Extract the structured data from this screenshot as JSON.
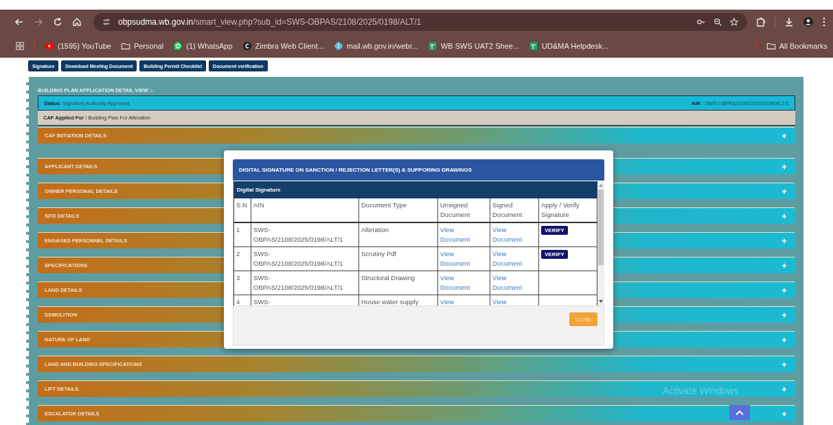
{
  "browser": {
    "url_host": "obpsudma.wb.gov.in",
    "url_path": "/smart_view.php?sub_id=SWS-OBPAS/2108/2025/0198/ALT/1",
    "bookmarks": [
      {
        "kind": "youtube",
        "label": "(1595) YouTube"
      },
      {
        "kind": "folder",
        "label": "Personal"
      },
      {
        "kind": "whatsapp",
        "label": "(1) WhatsApp"
      },
      {
        "kind": "zimbra",
        "label": "Zimbra Web Client..."
      },
      {
        "kind": "globe",
        "label": "mail.wb.gov.in/webr..."
      },
      {
        "kind": "sheet",
        "label": "WB SWS UAT2 Shee..."
      },
      {
        "kind": "sheet",
        "label": "UD&MA Helpdesk..."
      }
    ],
    "all_bookmarks": "All Bookmarks"
  },
  "top_buttons": [
    "Signature",
    "Download Meeting Document",
    "Building Permit Checklist",
    "Document verification"
  ],
  "panel": {
    "title": "BUILDING PLAN APPLICATION DETAIL VIEW :-",
    "status_label": "Status:",
    "status_value": "Signatory Authority Approved",
    "ain_label": "AIN",
    "ain_value": ": SWS-OBPAS/2108/2025/0198/ALT/1",
    "caf_label": "CAF Applied For :",
    "caf_value": "Building Plan For Alteration",
    "sections": [
      {
        "label": "CAF INITIATION DETAILS",
        "expanded": false
      },
      {
        "label": "APPLICANT DETAILS",
        "expanded": false
      },
      {
        "label": "OWNER PERSONAL DETAILS",
        "expanded": false
      },
      {
        "label": "SITE DETAILS",
        "expanded": false
      },
      {
        "label": "ENGAGED PERSONNEL DETAILS",
        "expanded": false
      },
      {
        "label": "SPECIFICATIONS",
        "expanded": false
      },
      {
        "label": "LAND DETAILS",
        "expanded": false
      },
      {
        "label": "DEMOLITION",
        "expanded": false
      },
      {
        "label": "NATURE OF LAND",
        "expanded": false
      },
      {
        "label": "LAND AND BUILDING SPECIFICATIONS",
        "expanded": false
      },
      {
        "label": "LIFT DETAILS",
        "expanded": false
      },
      {
        "label": "ESCALATOR DETAILS",
        "expanded": false
      }
    ]
  },
  "modal": {
    "title": "DIGITAL SIGNATURE ON SANCTION / REJECTION LETTER(S) & SUPPORING DRAWINGS",
    "subtitle": "Digital Signature",
    "columns": [
      "S.N",
      "AIN",
      "Document Type",
      "Unsigned Document",
      "Signed Document",
      "Apply / Verify Signature"
    ],
    "rows": [
      {
        "sn": "1",
        "ain": "SWS-OBPAS/2108/2025/0198/ALT/1",
        "type": "Alteration",
        "unsigned": "View Document",
        "signed": "View Document",
        "action": "VERIFY"
      },
      {
        "sn": "2",
        "ain": "SWS-OBPAS/2108/2025/0198/ALT/1",
        "type": "Scrutiny Pdf",
        "unsigned": "View Document",
        "signed": "View Document",
        "action": "VERIFY"
      },
      {
        "sn": "3",
        "ain": "SWS-OBPAS/2108/2025/0198/ALT/1",
        "type": "Structural Drawing",
        "unsigned": "View Document",
        "signed": "View Document"
      },
      {
        "sn": "4",
        "ain": "SWS-",
        "type": "House water supply",
        "unsigned": "View",
        "signed": "View"
      }
    ],
    "close": "CLOSE"
  },
  "os_notice": "Activate Windows"
}
